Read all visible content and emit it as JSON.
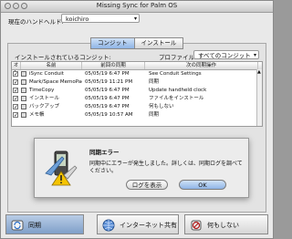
{
  "window": {
    "title": "Missing Sync for Palm OS"
  },
  "handheld": {
    "label": "現在のハンドヘルド:",
    "value": "koichiro"
  },
  "tabs": [
    {
      "label": "コンジット",
      "selected": true
    },
    {
      "label": "インストール",
      "selected": false
    }
  ],
  "conduits": {
    "installed_label": "インストールされているコンジット:",
    "profile_label": "プロファイル:",
    "profile_value": "すべてのコンジット",
    "headers": {
      "on": "オン",
      "name": "名前",
      "last_sync": "前回の同期",
      "next_action": "次の同期操作"
    },
    "rows": [
      {
        "checked": "✓",
        "name": "iSync Conduit",
        "last_sync": "05/05/19 6:47 PM",
        "next_action": "See Conduit Settings"
      },
      {
        "checked": "✓",
        "name": "Mark/Space MemoPad",
        "last_sync": "05/05/19 11:21 PM",
        "next_action": "同期"
      },
      {
        "checked": "✓",
        "name": "TimeCopy",
        "last_sync": "05/05/19 6:47 PM",
        "next_action": "Update handheld clock"
      },
      {
        "checked": "✓",
        "name": "インストール",
        "last_sync": "05/05/19 6:47 PM",
        "next_action": "ファイルをインストール"
      },
      {
        "checked": "✓",
        "name": "バックアップ",
        "last_sync": "05/05/19 6:47 PM",
        "next_action": "何もしない"
      },
      {
        "checked": "✓",
        "name": "メモ帳",
        "last_sync": "05/05/19 10:57 AM",
        "next_action": "同期"
      }
    ]
  },
  "dialog": {
    "title": "同期エラー",
    "message": "同期中にエラーが発生しました。詳しくは、同期ログを調べてください。",
    "log_button": "ログを表示",
    "ok_button": "OK"
  },
  "actions": [
    {
      "label": "同期",
      "active": true,
      "icon": "sync-icon"
    },
    {
      "label": "インターネット共有",
      "active": false,
      "icon": "internet-sharing-icon"
    },
    {
      "label": "何もしない",
      "active": false,
      "icon": "do-nothing-icon"
    }
  ]
}
